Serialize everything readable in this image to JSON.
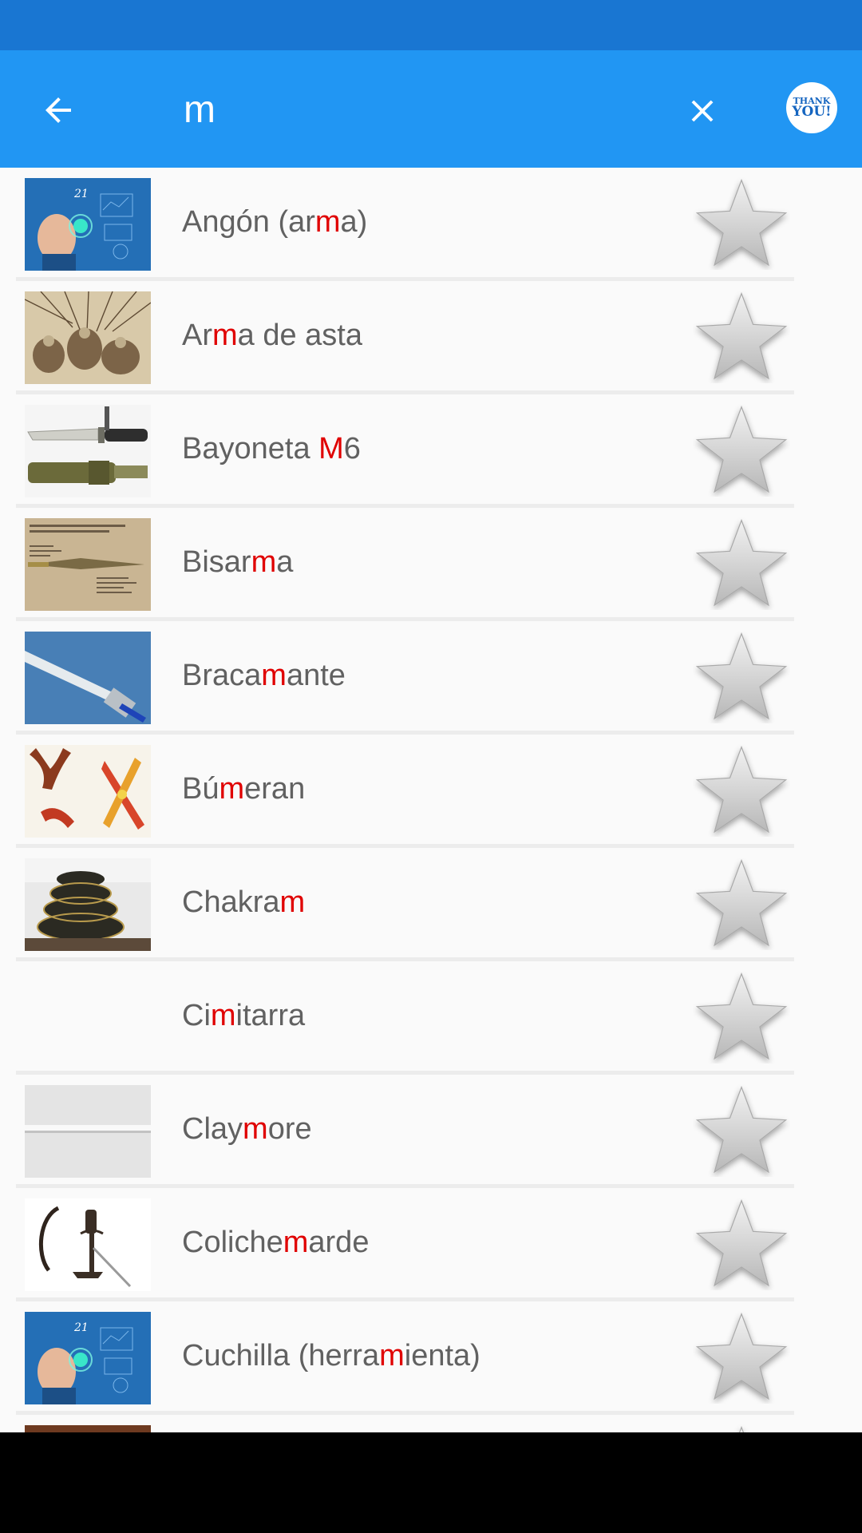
{
  "search": {
    "query": "m",
    "placeholder": ""
  },
  "header": {
    "thanks_line1": "THANK",
    "thanks_line2": "YOU!"
  },
  "colors": {
    "primary": "#2196f3",
    "status_bar": "#1976d2",
    "highlight": "#e00000",
    "item_text": "#616161"
  },
  "icons": {
    "back": "arrow-left-icon",
    "clear": "close-icon",
    "thanks": "thank-you-badge",
    "favorite": "star-icon"
  },
  "items": [
    {
      "pre": "Angón (ar",
      "match": "m",
      "post": "a)",
      "thumb": "hologram"
    },
    {
      "pre": "Ar",
      "match": "m",
      "post": "a de asta",
      "thumb": "sketch"
    },
    {
      "pre": "Bayoneta ",
      "match": "M",
      "post": "6",
      "thumb": "knife"
    },
    {
      "pre": "Bisar",
      "match": "m",
      "post": "a",
      "thumb": "doc"
    },
    {
      "pre": "Braca",
      "match": "m",
      "post": "ante",
      "thumb": "sword"
    },
    {
      "pre": "Bú",
      "match": "m",
      "post": "eran",
      "thumb": "boomerang"
    },
    {
      "pre": "Chakra",
      "match": "m",
      "post": "",
      "thumb": "stack"
    },
    {
      "pre": "Ci",
      "match": "m",
      "post": "itarra",
      "thumb": "none"
    },
    {
      "pre": "Clay",
      "match": "m",
      "post": "ore",
      "thumb": "rod"
    },
    {
      "pre": "Coliche",
      "match": "m",
      "post": "arde",
      "thumb": "rapier"
    },
    {
      "pre": "Cuchilla (herra",
      "match": "m",
      "post": "ienta)",
      "thumb": "hologram"
    },
    {
      "pre": "",
      "match": "",
      "post": "",
      "thumb": "partial"
    }
  ]
}
